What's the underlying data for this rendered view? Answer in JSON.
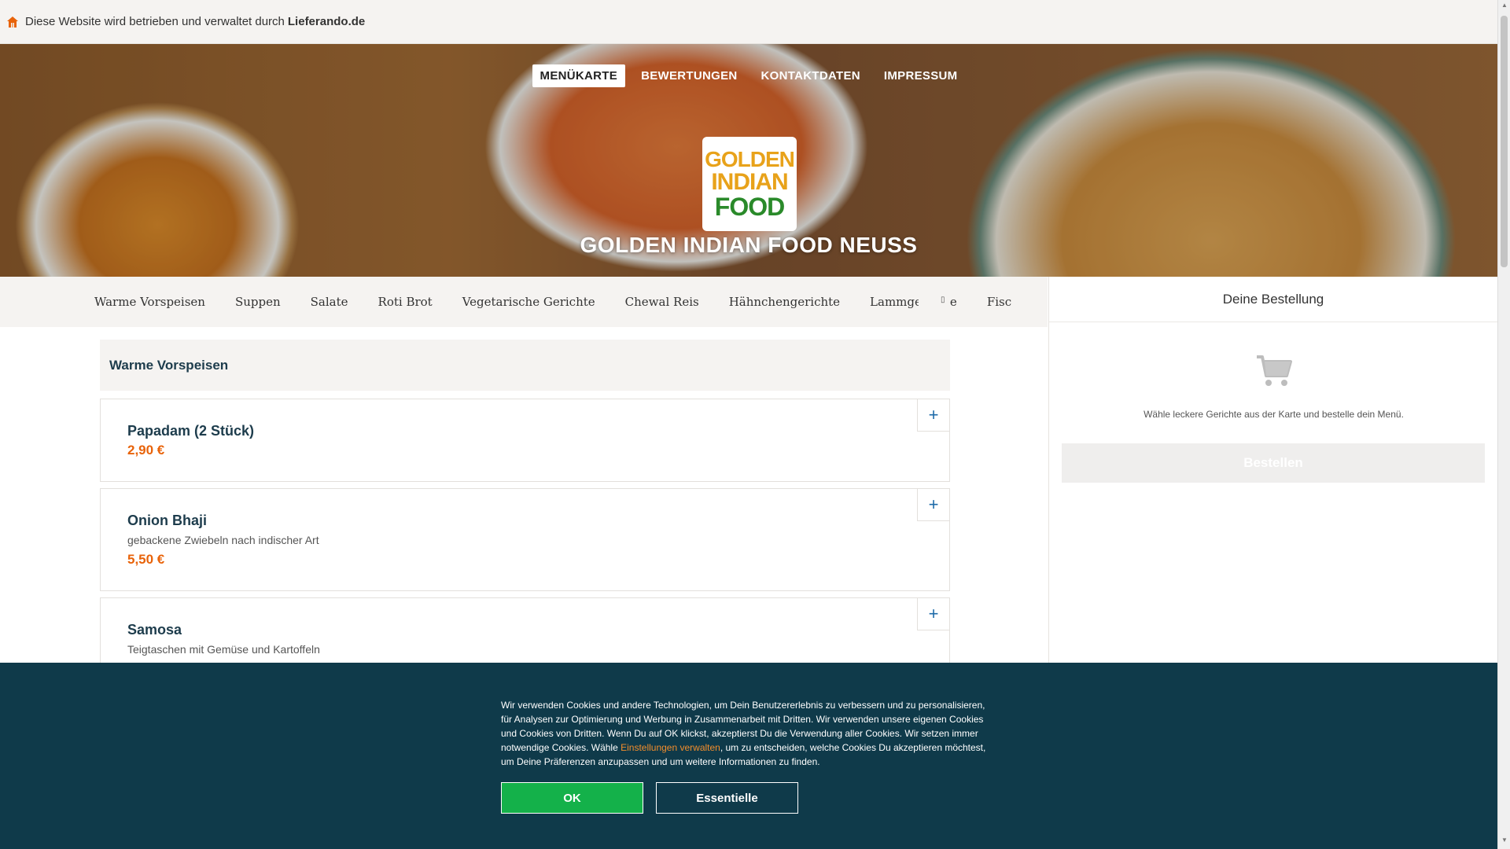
{
  "topbar": {
    "icon": "home-icon",
    "text": "Diese Website wird betrieben und verwaltet durch",
    "brand": "Lieferando.de"
  },
  "nav": {
    "items": [
      {
        "label": "MENÜKARTE",
        "active": true
      },
      {
        "label": "BEWERTUNGEN"
      },
      {
        "label": "KONTAKTDATEN"
      },
      {
        "label": "IMPRESSUM"
      }
    ]
  },
  "logo": {
    "line1": "GOLDEN",
    "line2": "INDIAN",
    "line3": "FOOD"
  },
  "restaurant_name": "GOLDEN INDIAN FOOD NEUSS",
  "categories": [
    "Warme Vorspeisen",
    "Suppen",
    "Salate",
    "Roti Brot",
    "Vegetarische Gerichte",
    "Chewal Reis",
    "Hähnchengerichte",
    "Lammgerichte",
    "Fisc"
  ],
  "section": {
    "title": "Warme Vorspeisen"
  },
  "dishes": [
    {
      "name": "Papadam (2 Stück)",
      "description": "",
      "price": "2,90 €"
    },
    {
      "name": "Onion Bhaji",
      "description": "gebackene Zwiebeln nach indischer Art",
      "price": "5,50 €"
    },
    {
      "name": "Samosa",
      "description": "Teigtaschen mit Gemüse und Kartoffeln",
      "price": ""
    }
  ],
  "add_label": "+",
  "basket": {
    "title": "Deine Bestellung",
    "icon": "shopping-cart-icon",
    "hint": "Wähle leckere Gerichte aus der Karte und bestelle dein Menü.",
    "order_button": "Bestellen"
  },
  "cookie": {
    "text_before": "Wir verwenden Cookies und andere Technologien, um Dein Benutzererlebnis zu verbessern und zu personalisieren, für Analysen zur Optimierung und Werbung in Zusammenarbeit mit Dritten. Wir verwenden unsere eigenen Cookies und Cookies von Dritten. Wenn Du auf OK klickst, akzeptierst Du die Verwendung aller Cookies. Wir setzen immer notwendige Cookies. Wähle ",
    "link": "Einstellungen verwalten",
    "text_after": ", um zu entscheiden, welche Cookies Du akzeptieren möchtest, um Deine Präferenzen anzupassen und um weitere Informationen zu finden.",
    "ok_label": "OK",
    "essential_label": "Essentielle"
  },
  "colors": {
    "accent": "#e8630a",
    "dark_teal": "#0f3a4a",
    "ok_green": "#14b14a",
    "link_orange": "#f28d2c"
  }
}
